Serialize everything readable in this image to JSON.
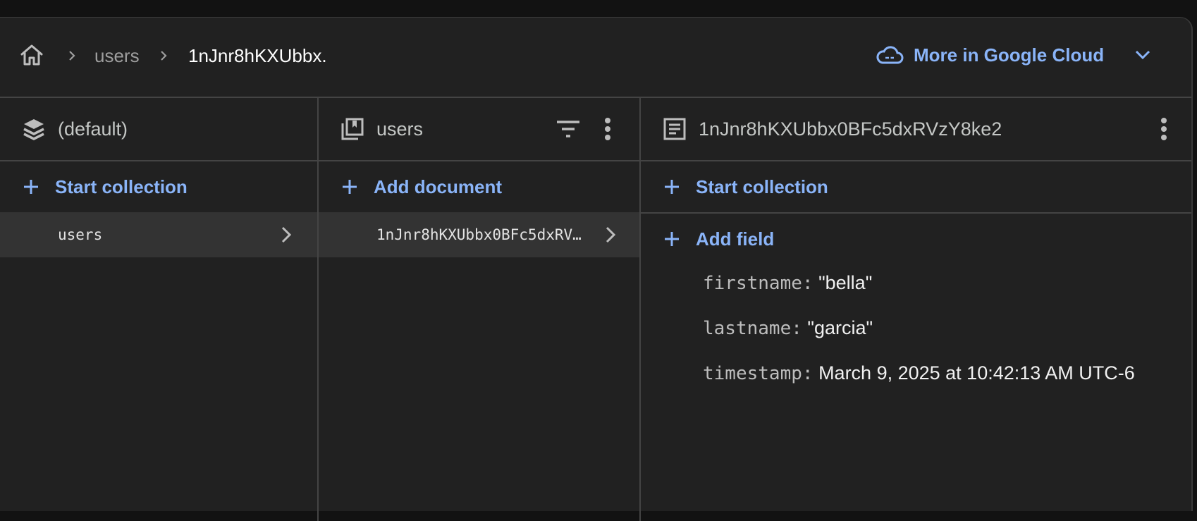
{
  "breadcrumb": {
    "items": [
      "users",
      "1nJnr8hKXUbbx."
    ]
  },
  "header": {
    "more_label": "More in Google Cloud"
  },
  "colors": {
    "accent": "#8ab4f8",
    "background": "#212121",
    "selected_row": "#333333"
  },
  "columns": {
    "database": {
      "title": "(default)",
      "action_label": "Start collection",
      "items": [
        {
          "label": "users"
        }
      ]
    },
    "collection": {
      "title": "users",
      "action_label": "Add document",
      "items": [
        {
          "label": "1nJnr8hKXUbbx0BFc5dxRV…"
        }
      ]
    },
    "document": {
      "title": "1nJnr8hKXUbbx0BFc5dxRVzY8ke2",
      "action_label": "Start collection",
      "add_field_label": "Add field",
      "fields": [
        {
          "key": "firstname:",
          "value": "\"bella\""
        },
        {
          "key": "lastname:",
          "value": "\"garcia\""
        },
        {
          "key": "timestamp:",
          "value": "March 9, 2025 at 10:42:13 AM UTC-6"
        }
      ]
    }
  },
  "icons": {
    "home": "home-icon",
    "database": "database-stack-icon",
    "collection": "collection-icon",
    "document": "document-icon",
    "filter": "filter-icon",
    "more": "more-vert-icon",
    "cloud": "cloud-icon"
  }
}
